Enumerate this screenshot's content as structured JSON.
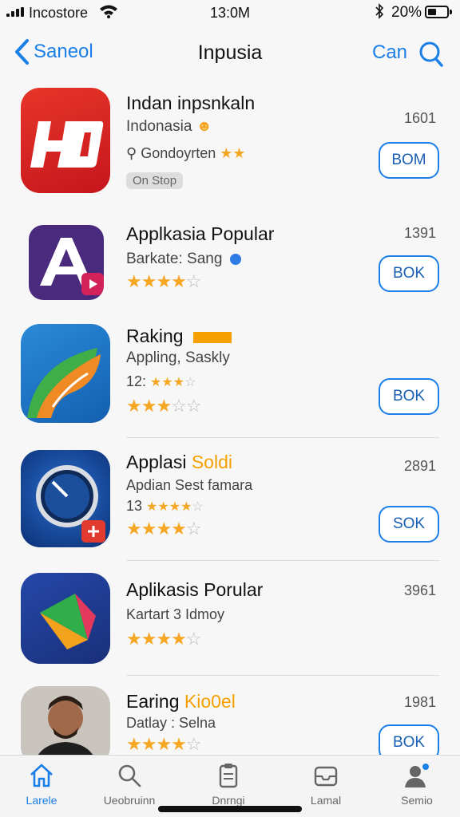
{
  "status_bar": {
    "carrier": "Incostore",
    "time": "13:0M",
    "battery": "20%"
  },
  "nav": {
    "back_label": "Saneol",
    "title": "Inpusia",
    "cancel_label": "Can"
  },
  "apps": [
    {
      "name": "Indan inpsnkaln",
      "line1": "Indonasia",
      "line2": "Gondoyrten",
      "tag": "On Stop",
      "size": "1601",
      "button": "BOM",
      "rating": 2
    },
    {
      "name": "Applkasia Popular",
      "line1": "Barkate: Sang",
      "size": "1391",
      "button": "BOK",
      "rating": 3.5
    },
    {
      "name": "Raking",
      "line1": "Appling, Saskly",
      "line2_prefix": "12:",
      "size": "",
      "button": "BOK",
      "rating": 3
    },
    {
      "name_prefix": "Applasi",
      "name_accent": "Soldi",
      "line1": "Apdian Sest famara",
      "line2_prefix": "13",
      "size": "2891",
      "button": "SOK",
      "rating": 3.5
    },
    {
      "name": "Aplikasis Porular",
      "line1": "Kartart 3 Idmoy",
      "size": "3961",
      "button": "",
      "rating": 3.5
    },
    {
      "name_prefix": "Earing",
      "name_accent": "Kio0el",
      "line1": "Datlay : Selna",
      "size": "1981",
      "button": "BOK",
      "rating": 3.5
    }
  ],
  "tabs": [
    {
      "label": "Larele",
      "icon": "home-icon"
    },
    {
      "label": "Ueobruinn",
      "icon": "search-icon"
    },
    {
      "label": "Dnrngi",
      "icon": "clipboard-icon"
    },
    {
      "label": "Lamal",
      "icon": "inbox-icon"
    },
    {
      "label": "Semio",
      "icon": "person-icon"
    }
  ],
  "colors": {
    "accent": "#1a7fe6",
    "star": "#f5a623",
    "highlight": "#f5a000"
  }
}
